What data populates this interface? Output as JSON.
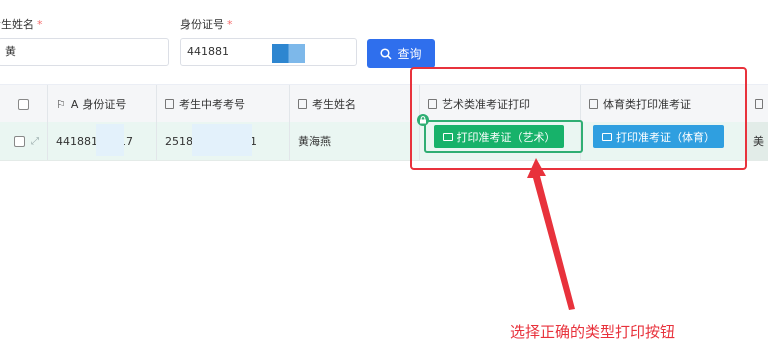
{
  "form": {
    "name_label": "考生姓名",
    "name_value": "黄",
    "id_label": "身份证号",
    "id_value": "441881",
    "required_mark": "*",
    "query_button": "查询"
  },
  "table": {
    "headers": [
      "身份证号",
      "考生中考考号",
      "考生姓名",
      "艺术类准考证打印",
      "体育类打印准考证"
    ],
    "row": {
      "id_number": "441881",
      "id_number_tail": "517",
      "exam_number": "2518",
      "exam_number_tail": "31",
      "name": "黄海燕",
      "last_col_fragment": "美"
    },
    "art_button": "打印准考证（艺术）",
    "pe_button": "打印准考证（体育）"
  },
  "annotation": "选择正确的类型打印按钮",
  "colors": {
    "primary": "#2f6fed",
    "art_green": "#17b26a",
    "pe_blue": "#2f9fe0",
    "annotation_red": "#e8323c"
  }
}
